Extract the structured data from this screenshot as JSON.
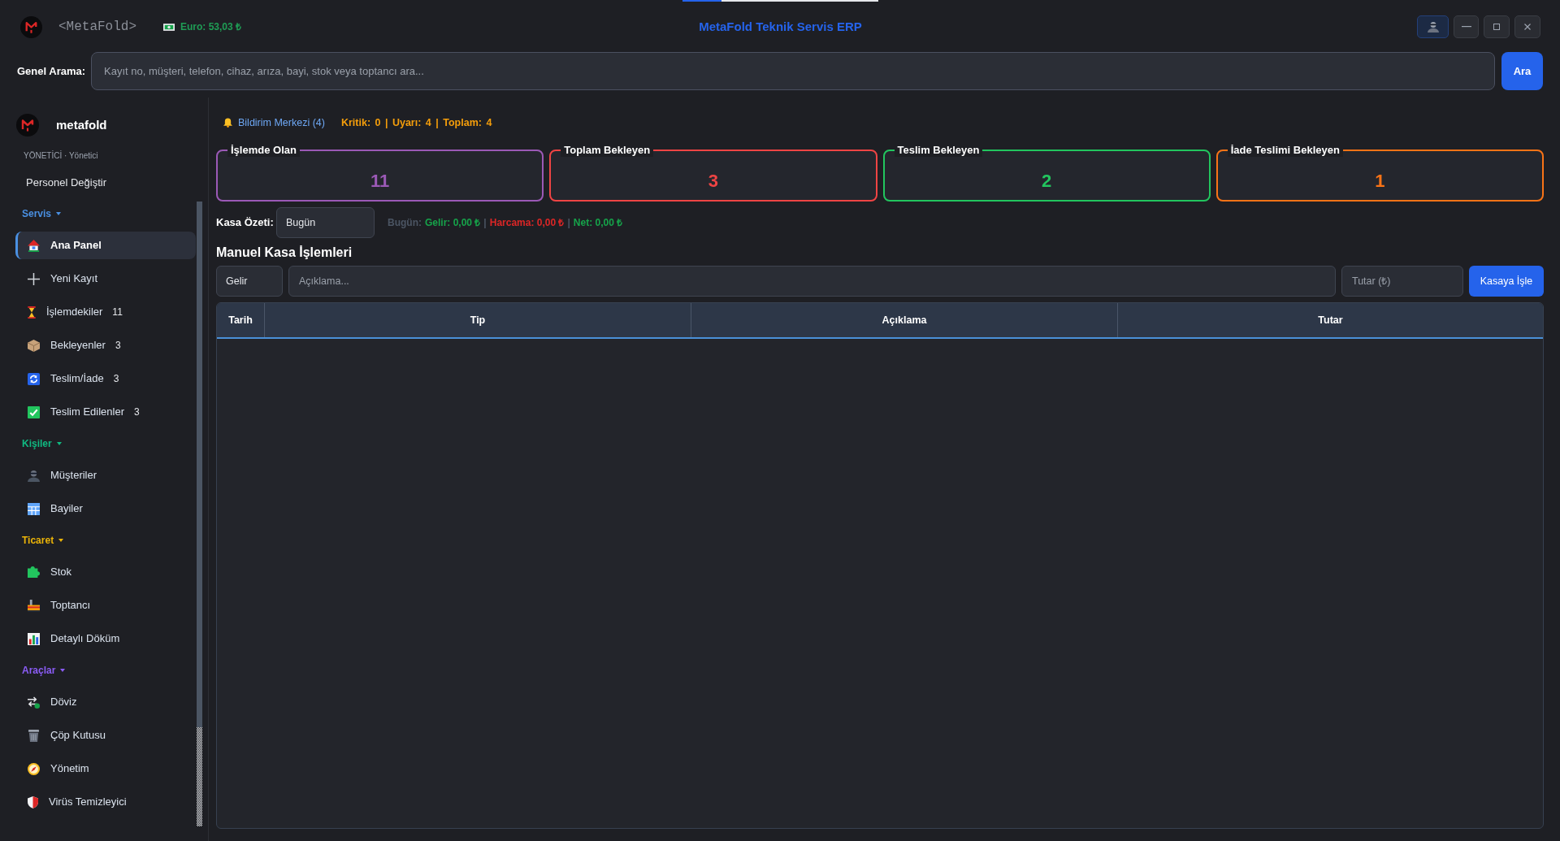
{
  "header": {
    "app_tag": "<MetaFold>",
    "currency": "Euro: 53,03 ₺",
    "title": "MetaFold Teknik Servis ERP"
  },
  "search": {
    "label": "Genel Arama:",
    "placeholder": "Kayıt no, müşteri, telefon, cihaz, arıza, bayi, stok veya toptancı ara...",
    "button": "Ara"
  },
  "sidebar": {
    "username": "metafold",
    "role": "YÖNETİCİ · Yönetici",
    "switch_user": "Personel Değiştir",
    "sections": [
      {
        "title": "Servis",
        "color": "#4a90e2",
        "expanded": true,
        "items": [
          {
            "label": "Ana Panel",
            "selected": true
          },
          {
            "label": "Yeni Kayıt",
            "selected": false
          },
          {
            "label": "İşlemdekiler",
            "count": "11",
            "selected": false
          },
          {
            "label": "Bekleyenler",
            "count": "3",
            "selected": false
          },
          {
            "label": "Teslim/İade",
            "count": "3",
            "selected": false
          },
          {
            "label": "Teslim Edilenler",
            "count": "3",
            "selected": false
          }
        ]
      },
      {
        "title": "Kişiler",
        "color": "#10b981",
        "expanded": true,
        "items": [
          {
            "label": "Müşteriler",
            "selected": false
          },
          {
            "label": "Bayiler",
            "selected": false
          }
        ]
      },
      {
        "title": "Ticaret",
        "color": "#eab308",
        "expanded": true,
        "items": [
          {
            "label": "Stok",
            "selected": false
          },
          {
            "label": "Toptancı",
            "selected": false
          },
          {
            "label": "Detaylı Döküm",
            "selected": false
          }
        ]
      },
      {
        "title": "Araçlar",
        "color": "#8b5cf6",
        "expanded": true,
        "items": [
          {
            "label": "Döviz",
            "selected": false
          },
          {
            "label": "Çöp Kutusu",
            "selected": false
          },
          {
            "label": "Yönetim",
            "selected": false
          },
          {
            "label": "Virüs Temizleyici",
            "selected": false
          }
        ]
      }
    ]
  },
  "notifications": {
    "label": "Bildirim Merkezi (4)",
    "stats": "Kritik: 0 | Uyarı: 4 | Toplam: 4"
  },
  "cards": [
    {
      "title": "İşlemde Olan",
      "value": "11",
      "color": "#9b59b6"
    },
    {
      "title": "Toplam Bekleyen",
      "value": "3",
      "color": "#ef4444"
    },
    {
      "title": "Teslim Bekleyen",
      "value": "2",
      "color": "#22c55e"
    },
    {
      "title": "İade Teslimi Bekleyen",
      "value": "1",
      "color": "#f97316"
    }
  ],
  "cash_summary": {
    "label": "Kasa Özeti:",
    "period": "Bugün",
    "parts": [
      {
        "text": "Bugün:",
        "color": "#4b5563"
      },
      {
        "text": "Gelir: 0,00 ₺",
        "color": "#16a34a"
      },
      {
        "text": "|",
        "color": "#4b5563"
      },
      {
        "text": "Harcama: 0,00 ₺",
        "color": "#dc2626"
      },
      {
        "text": "|",
        "color": "#4b5563"
      },
      {
        "text": "Net: 0,00 ₺",
        "color": "#16a34a"
      }
    ]
  },
  "manual_cash": {
    "title": "Manuel Kasa İşlemleri",
    "type": "Gelir",
    "description_placeholder": "Açıklama...",
    "amount_placeholder": "Tutar (₺)",
    "button": "Kasaya İşle"
  },
  "table": {
    "columns": [
      "Tarih",
      "Tip",
      "Açıklama",
      "Tutar"
    ]
  }
}
